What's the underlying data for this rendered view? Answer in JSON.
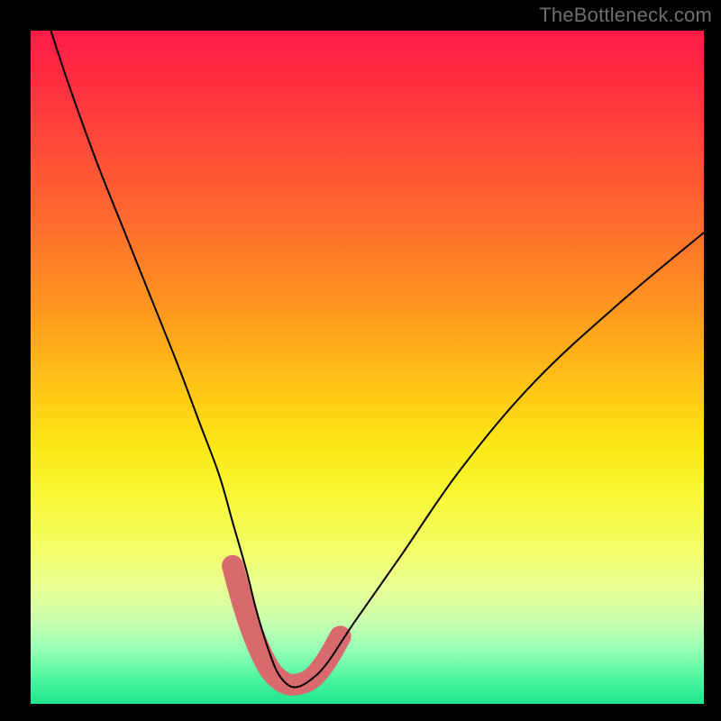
{
  "watermark": "TheBottleneck.com",
  "chart_data": {
    "type": "line",
    "title": "",
    "xlabel": "",
    "ylabel": "",
    "xlim": [
      0,
      100
    ],
    "ylim": [
      0,
      100
    ],
    "grid": false,
    "legend": false,
    "series": [
      {
        "name": "bottleneck-curve",
        "x": [
          3,
          6,
          10,
          14,
          18,
          22,
          25,
          28,
          30,
          32,
          33.5,
          35,
          36.5,
          38,
          39.5,
          41.5,
          44,
          48,
          55,
          64,
          75,
          88,
          100
        ],
        "y": [
          100,
          91,
          80,
          70,
          60,
          50,
          42,
          34,
          27,
          20,
          14,
          9,
          5,
          3,
          2.5,
          3.5,
          6,
          12,
          22,
          35,
          48,
          60,
          70
        ],
        "stroke": "#000000",
        "stroke_width": 1.4
      },
      {
        "name": "highlight-floor",
        "x": [
          30,
          31.5,
          33,
          34.5,
          36,
          38,
          40,
          42,
          44,
          46
        ],
        "y": [
          20.5,
          15,
          10.5,
          7,
          4.5,
          3,
          3,
          4,
          6.5,
          10
        ],
        "stroke": "#d86a6e",
        "stroke_width": 12,
        "linecap": "round"
      }
    ],
    "background_gradient": {
      "top": "#ff1a47",
      "mid": "#ffd31a",
      "bottom": "#1de58c"
    }
  }
}
